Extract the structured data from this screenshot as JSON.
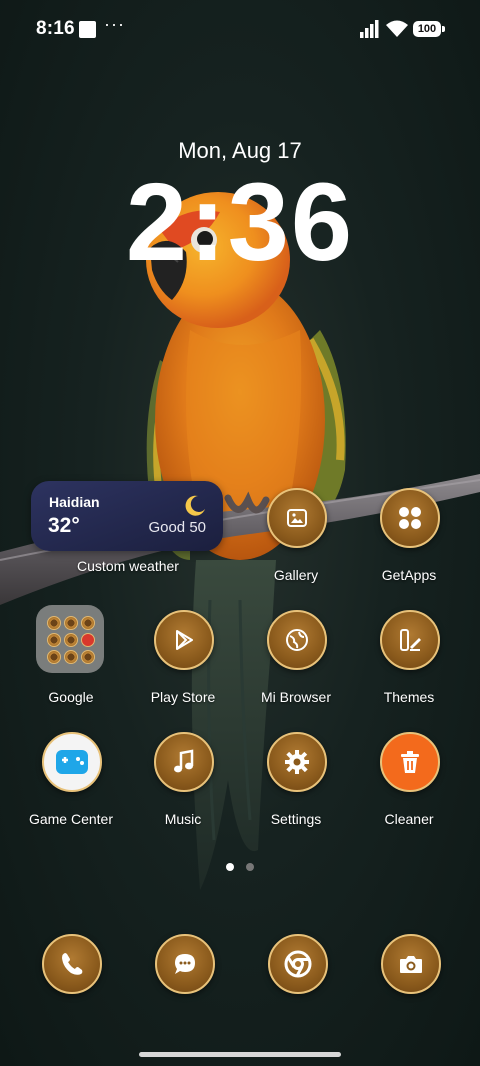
{
  "status_bar": {
    "time": "8:16",
    "dots": "···",
    "battery": "100"
  },
  "lockscreen": {
    "date": "Mon, Aug 17",
    "time": "2:36"
  },
  "weather_widget": {
    "city": "Haidian",
    "temperature": "32°",
    "air_quality": "Good 50",
    "icon": "crescent-moon-icon",
    "label": "Custom weather"
  },
  "apps": {
    "row1": [
      {
        "label": "Gallery",
        "icon": "gallery-icon"
      },
      {
        "label": "GetApps",
        "icon": "getapps-icon"
      }
    ],
    "row2": [
      {
        "label": "Google",
        "icon": "google-folder-icon"
      },
      {
        "label": "Play Store",
        "icon": "play-store-icon"
      },
      {
        "label": "Mi Browser",
        "icon": "globe-icon"
      },
      {
        "label": "Themes",
        "icon": "themes-icon"
      }
    ],
    "row3": [
      {
        "label": "Game Center",
        "icon": "gamepad-icon"
      },
      {
        "label": "Music",
        "icon": "music-note-icon"
      },
      {
        "label": "Settings",
        "icon": "gear-icon"
      },
      {
        "label": "Cleaner",
        "icon": "trash-icon"
      }
    ]
  },
  "pager": {
    "pages": 2,
    "current": 1
  },
  "dock": [
    {
      "icon": "phone-icon"
    },
    {
      "icon": "messages-icon"
    },
    {
      "icon": "chrome-icon"
    },
    {
      "icon": "camera-icon"
    }
  ],
  "colors": {
    "icon_gold": "#8a5a1c",
    "icon_ring": "#e8c27a",
    "widget_bg": "#1b1f3e",
    "moon": "#f5c84a",
    "cleaner_orange": "#f36a1c"
  }
}
